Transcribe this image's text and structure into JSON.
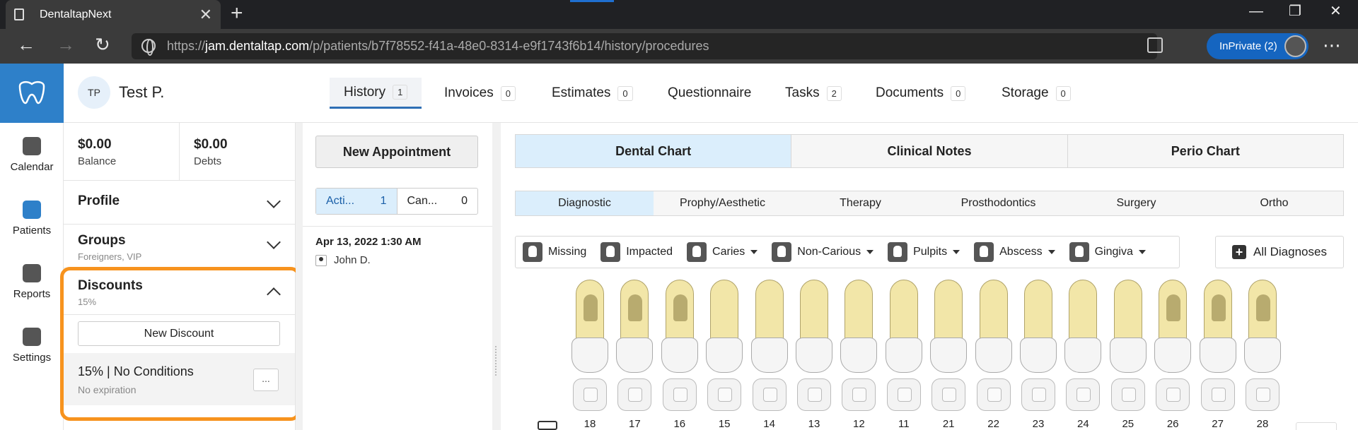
{
  "browser": {
    "tab_title": "DentaltapNext",
    "url_prefix": "https://",
    "url_host": "jam.dentaltap.com",
    "url_path": "/p/patients/b7f78552-f41a-48e0-8314-e9f1743f6b14/history/procedures",
    "inprivate_label": "InPrivate (2)"
  },
  "rail": {
    "items": [
      {
        "label": "Calendar",
        "icon": "calendar-icon"
      },
      {
        "label": "Patients",
        "icon": "patients-icon"
      },
      {
        "label": "Reports",
        "icon": "reports-icon"
      },
      {
        "label": "Settings",
        "icon": "settings-icon"
      }
    ]
  },
  "patient": {
    "initials": "TP",
    "name": "Test P."
  },
  "patient_tabs": [
    {
      "label": "History",
      "count": "1"
    },
    {
      "label": "Invoices",
      "count": "0"
    },
    {
      "label": "Estimates",
      "count": "0"
    },
    {
      "label": "Questionnaire",
      "count": ""
    },
    {
      "label": "Tasks",
      "count": "2"
    },
    {
      "label": "Documents",
      "count": "0"
    },
    {
      "label": "Storage",
      "count": "0"
    }
  ],
  "balance": {
    "amount": "$0.00",
    "label": "Balance"
  },
  "debts": {
    "amount": "$0.00",
    "label": "Debts"
  },
  "profile": {
    "title": "Profile"
  },
  "groups": {
    "title": "Groups",
    "subtitle": "Foreigners, VIP"
  },
  "discounts": {
    "title": "Discounts",
    "subtitle": "15%",
    "new_label": "New Discount",
    "item_title": "15% | No Conditions",
    "item_subtitle": "No expiration",
    "more_label": "..."
  },
  "appointments": {
    "new_label": "New Appointment",
    "tabs": [
      {
        "label": "Acti...",
        "count": "1"
      },
      {
        "label": "Can...",
        "count": "0"
      }
    ],
    "items": [
      {
        "date": "Apr 13, 2022 1:30 AM",
        "provider": "John D."
      }
    ]
  },
  "chart_tabs": [
    "Dental Chart",
    "Clinical Notes",
    "Perio Chart"
  ],
  "sub_tabs": [
    "Diagnostic",
    "Prophy/Aesthetic",
    "Therapy",
    "Prosthodontics",
    "Surgery",
    "Ortho"
  ],
  "diagnoses": [
    {
      "label": "Missing",
      "dropdown": false,
      "icon": "missing-icon"
    },
    {
      "label": "Impacted",
      "dropdown": false,
      "icon": "impacted-icon"
    },
    {
      "label": "Caries",
      "dropdown": true,
      "icon": "caries-icon"
    },
    {
      "label": "Non-Carious",
      "dropdown": true,
      "icon": "non-carious-icon"
    },
    {
      "label": "Pulpits",
      "dropdown": true,
      "icon": "pulpits-icon"
    },
    {
      "label": "Abscess",
      "dropdown": true,
      "icon": "abscess-icon"
    },
    {
      "label": "Gingiva",
      "dropdown": true,
      "icon": "gingiva-icon"
    }
  ],
  "all_diagnoses_label": "All Diagnoses",
  "teeth": [
    "18",
    "17",
    "16",
    "15",
    "14",
    "13",
    "12",
    "11",
    "21",
    "22",
    "23",
    "24",
    "25",
    "26",
    "27",
    "28"
  ],
  "colors": {
    "brand": "#2e80c9",
    "highlight": "#f7931e",
    "active_tab_bg": "#dbeefc"
  }
}
